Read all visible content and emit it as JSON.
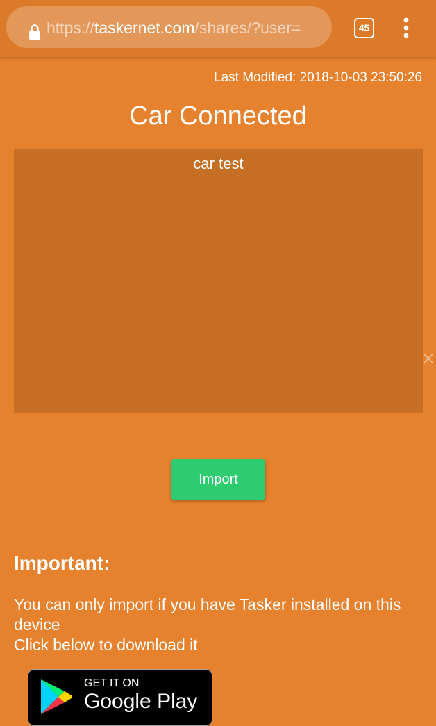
{
  "browser": {
    "url_scheme": "https://",
    "url_host": "taskernet.com",
    "url_path": "/shares/?user=",
    "tab_count": "45",
    "icons": {
      "lock": "lock-icon",
      "menu": "more-vert-icon"
    }
  },
  "page": {
    "last_modified": "Last Modified: 2018-10-03 23:50:26",
    "title": "Car Connected",
    "description": "car test",
    "import_label": "Import",
    "important_heading": "Important:",
    "info_line1": "You can only import if you have Tasker installed on this device",
    "info_line2": "Click below to download it",
    "badge_small": "GET IT ON",
    "badge_large": "Google Play",
    "icons": {
      "close": "close-icon",
      "play": "google-play-icon"
    }
  },
  "colors": {
    "background": "#e6812e",
    "toolbar": "#dc7a2a",
    "panel": "#c56e24",
    "import_button": "#2ecc71",
    "text": "#ffffff"
  }
}
